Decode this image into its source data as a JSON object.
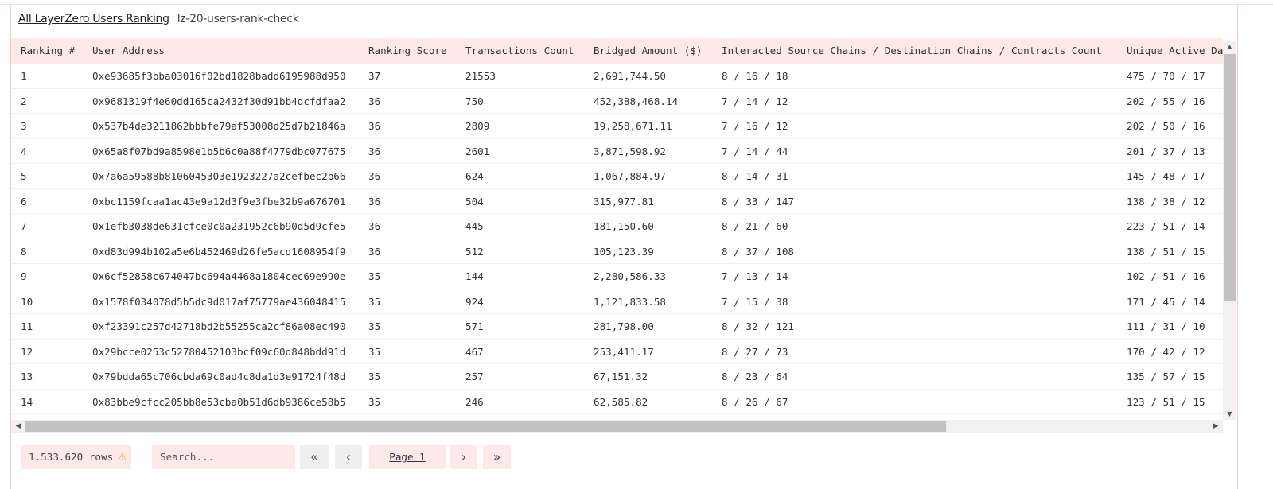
{
  "header": {
    "title": "All LayerZero Users Ranking",
    "subtitle": "lz-20-users-rank-check"
  },
  "table": {
    "columns": [
      "Ranking #",
      "User Address",
      "Ranking Score",
      "Transactions Count",
      "Bridged Amount ($)",
      "Interacted Source Chains / Destination Chains / Contracts Count",
      "Unique Active Da"
    ],
    "rows": [
      [
        "1",
        "0xe93685f3bba03016f02bd1828badd6195988d950",
        "37",
        "21553",
        "2,691,744.50",
        "8 / 16 / 18",
        "475 / 70 / 17"
      ],
      [
        "2",
        "0x9681319f4e60dd165ca2432f30d91bb4dcfdfaa2",
        "36",
        "750",
        "452,388,468.14",
        "7 / 14 / 12",
        "202 / 55 / 16"
      ],
      [
        "3",
        "0x537b4de3211862bbbfe79af53008d25d7b21846a",
        "36",
        "2809",
        "19,258,671.11",
        "7 / 16 / 12",
        "202 / 50 / 16"
      ],
      [
        "4",
        "0x65a8f07bd9a8598e1b5b6c0a88f4779dbc077675",
        "36",
        "2601",
        "3,871,598.92",
        "7 / 14 / 44",
        "201 / 37 / 13"
      ],
      [
        "5",
        "0x7a6a59588b8106045303e1923227a2cefbec2b66",
        "36",
        "624",
        "1,067,884.97",
        "8 / 14 / 31",
        "145 / 48 / 17"
      ],
      [
        "6",
        "0xbc1159fcaa1ac43e9a12d3f9e3fbe32b9a676701",
        "36",
        "504",
        "315,977.81",
        "8 / 33 / 147",
        "138 / 38 / 12"
      ],
      [
        "7",
        "0x1efb3038de631cfce0c0a231952c6b90d5d9cfe5",
        "36",
        "445",
        "181,150.60",
        "8 / 21 / 60",
        "223 / 51 / 14"
      ],
      [
        "8",
        "0xd83d994b102a5e6b452469d26fe5acd1608954f9",
        "36",
        "512",
        "105,123.39",
        "8 / 37 / 108",
        "138 / 51 / 15"
      ],
      [
        "9",
        "0x6cf52858c674047bc694a4468a1804cec69e990e",
        "35",
        "144",
        "2,280,586.33",
        "7 / 13 / 14",
        "102 / 51 / 16"
      ],
      [
        "10",
        "0x1578f034078d5b5dc9d017af75779ae436048415",
        "35",
        "924",
        "1,121,833.58",
        "7 / 15 / 38",
        "171 / 45 / 14"
      ],
      [
        "11",
        "0xf23391c257d42718bd2b55255ca2cf86a08ec490",
        "35",
        "571",
        "281,798.00",
        "8 / 32 / 121",
        "111 / 31 / 10"
      ],
      [
        "12",
        "0x29bcce0253c52780452103bcf09c60d848bdd91d",
        "35",
        "467",
        "253,411.17",
        "8 / 27 / 73",
        "170 / 42 / 12"
      ],
      [
        "13",
        "0x79bdda65c706cbda69c0ad4c8da1d3e91724f48d",
        "35",
        "257",
        "67,151.32",
        "8 / 23 / 64",
        "135 / 57 / 15"
      ],
      [
        "14",
        "0x83bbe9cfcc205bb8e53cba0b51d6db9386ce58b5",
        "35",
        "246",
        "62,585.82",
        "8 / 26 / 67",
        "123 / 51 / 15"
      ]
    ]
  },
  "footer": {
    "row_count": "1.533.620 rows",
    "search_placeholder": "Search...",
    "first": "«",
    "prev": "‹",
    "page": "Page 1",
    "next": "›",
    "last": "»",
    "warning_icon": "⚠"
  },
  "colors": {
    "header_bg": "#fde9e8",
    "accent_border": "#f6c9c4",
    "warning": "#f0a030"
  }
}
